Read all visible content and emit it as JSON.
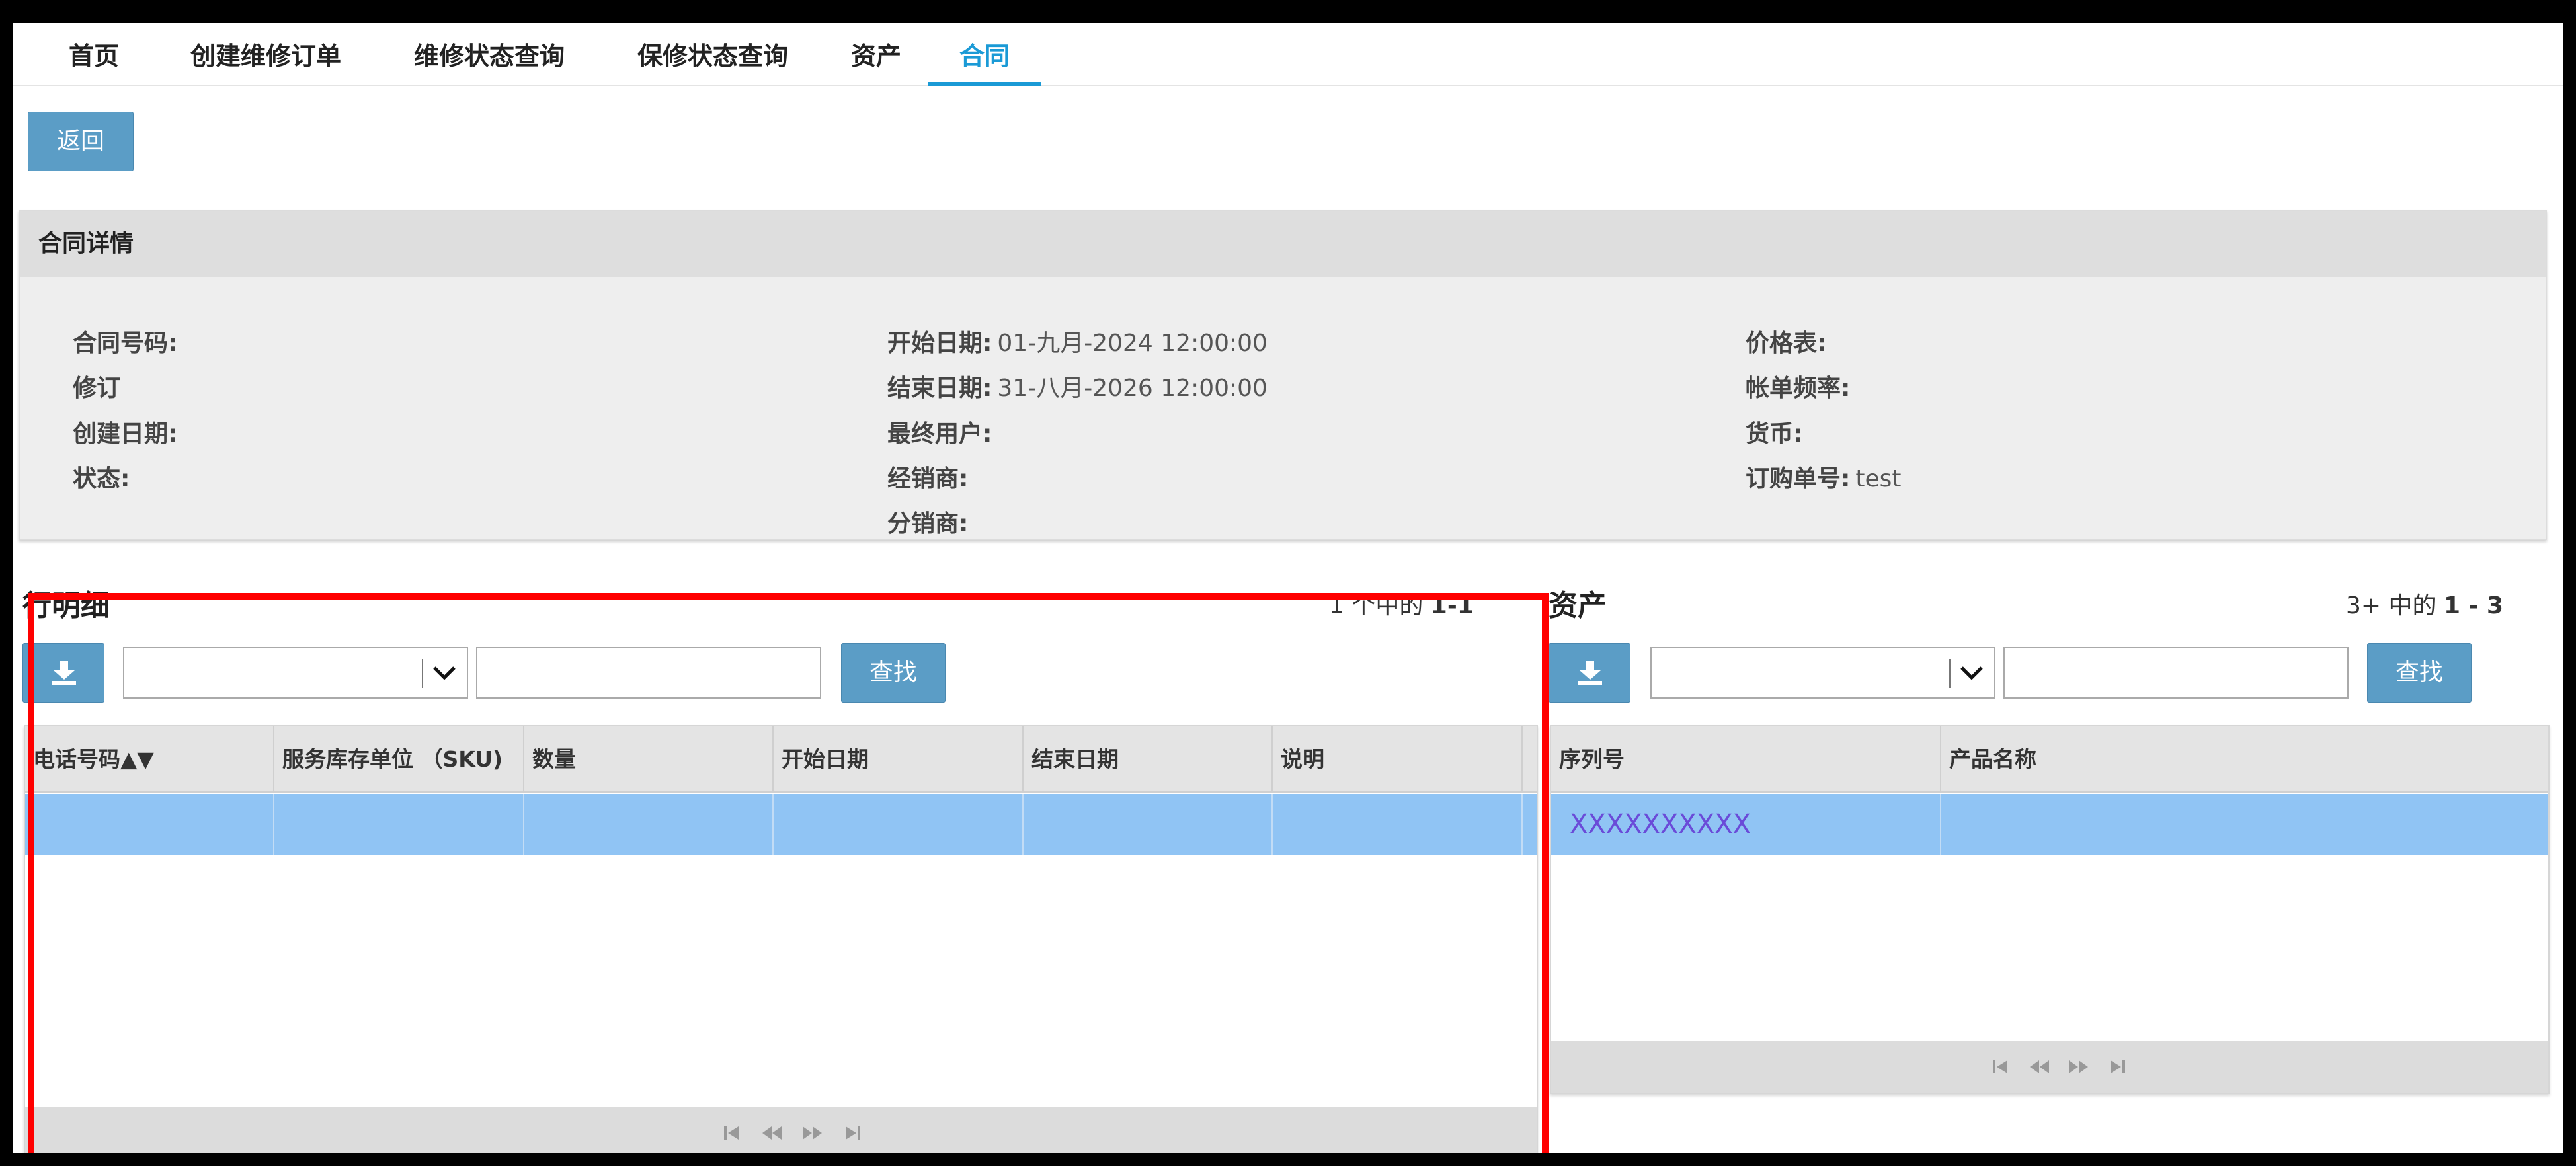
{
  "nav": {
    "tabs": [
      {
        "label": "首页"
      },
      {
        "label": "创建维修订单"
      },
      {
        "label": "维修状态查询"
      },
      {
        "label": "保修状态查询"
      },
      {
        "label": "资产"
      },
      {
        "label": "合同"
      }
    ],
    "active_index": 5
  },
  "back_label": "返回",
  "contract": {
    "header": "合同详情",
    "col1": [
      {
        "label": "合同号码:",
        "value": ""
      },
      {
        "label": "修订",
        "value": ""
      },
      {
        "label": "创建日期:",
        "value": ""
      },
      {
        "label": "状态:",
        "value": ""
      }
    ],
    "col2": [
      {
        "label": "开始日期:",
        "value": "01-九月-2024 12:00:00"
      },
      {
        "label": "结束日期:",
        "value": "31-八月-2026 12:00:00"
      },
      {
        "label": "最终用户:",
        "value": ""
      },
      {
        "label": "经销商:",
        "value": ""
      },
      {
        "label": "分销商:",
        "value": ""
      }
    ],
    "col3": [
      {
        "label": "价格表:",
        "value": ""
      },
      {
        "label": "帐单频率:",
        "value": ""
      },
      {
        "label": "货币:",
        "value": ""
      },
      {
        "label": "订购单号:",
        "value": "test"
      }
    ]
  },
  "line_details": {
    "title": "行明细",
    "pager": {
      "prefix": "1 个中的 ",
      "range": "1-1"
    },
    "search_value": "",
    "find_label": "查找",
    "columns": [
      "电话号码▲▼",
      "服务库存单位 （SKU)",
      "数量",
      "开始日期",
      "结束日期",
      "说明"
    ],
    "rows": [
      [
        "",
        "",
        "",
        "",
        "",
        ""
      ]
    ]
  },
  "assets": {
    "title": "资产",
    "pager": {
      "prefix": "3+ 中的 ",
      "range": "1 - 3"
    },
    "search_value": "",
    "find_label": "查找",
    "columns": [
      "序列号",
      "产品名称"
    ],
    "rows": [
      [
        "XXXXXXXXXX",
        ""
      ]
    ]
  },
  "colors": {
    "accent": "#1a9ad6",
    "button": "#5b9dc6",
    "selected_row": "#90c4f4",
    "highlight": "#ff0000"
  },
  "icons": [
    "download-icon",
    "chevron-down-icon",
    "first-page-icon",
    "prev-page-icon",
    "next-page-icon",
    "last-page-icon"
  ]
}
